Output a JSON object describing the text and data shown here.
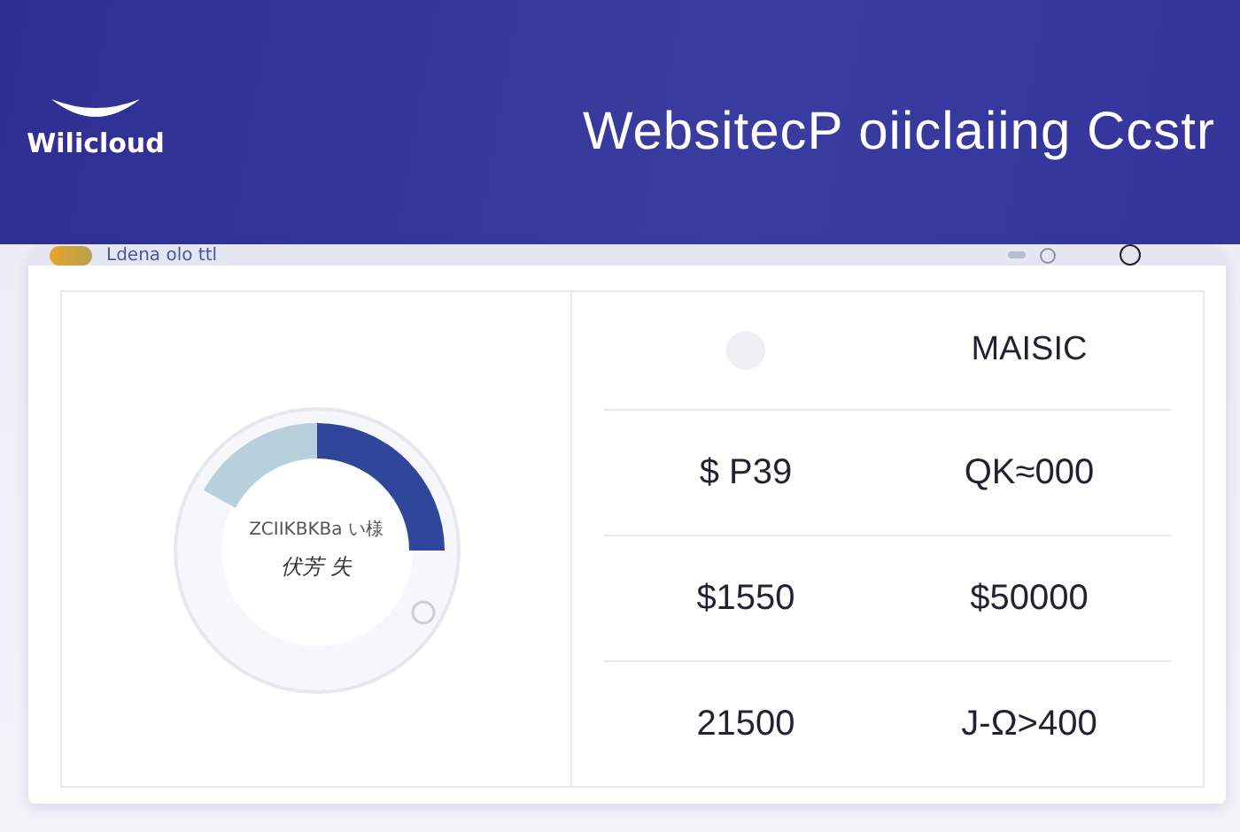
{
  "brand": {
    "name": "Wilicloud"
  },
  "title": "WebsitecP oiiclaiing Ccstr",
  "toolbar": {
    "label": "Ldena olo ttl"
  },
  "donut": {
    "line_1": "ZCIIKBKBa い様",
    "line_2": "伏芳 失"
  },
  "table": {
    "header": "MAISIC",
    "rows": [
      [
        "$ P39",
        "QK≈000"
      ],
      [
        "$1550",
        "$50000"
      ],
      [
        "21500",
        "J-Ω>400"
      ]
    ]
  }
}
